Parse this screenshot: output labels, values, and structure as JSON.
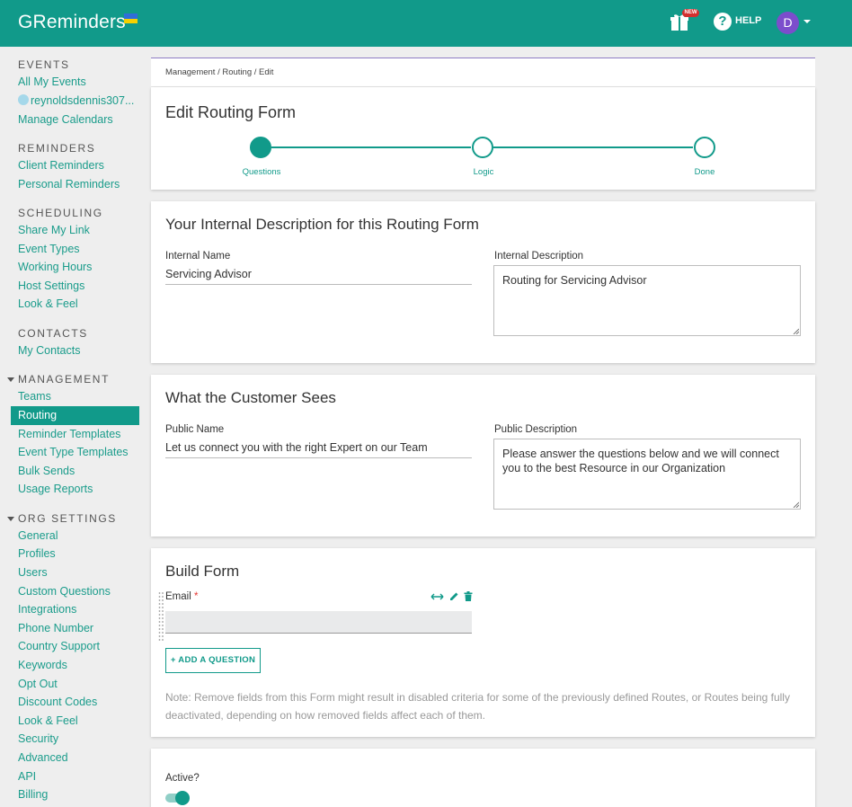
{
  "app": {
    "logo_text": "GReminders",
    "help_label": "HELP",
    "avatar_initial": "D",
    "new_badge": "NEW"
  },
  "sidebar": {
    "events_header": "EVENTS",
    "all_my_events": "All My Events",
    "calendar_account": "reynoldsdennis307...",
    "manage_calendars": "Manage Calendars",
    "reminders_header": "REMINDERS",
    "client_reminders": "Client Reminders",
    "personal_reminders": "Personal Reminders",
    "scheduling_header": "SCHEDULING",
    "share_my_link": "Share My Link",
    "event_types": "Event Types",
    "working_hours": "Working Hours",
    "host_settings": "Host Settings",
    "look_feel_scheduling": "Look & Feel",
    "contacts_header": "CONTACTS",
    "my_contacts": "My Contacts",
    "management_header": "MANAGEMENT",
    "teams": "Teams",
    "routing": "Routing",
    "reminder_templates": "Reminder Templates",
    "event_type_templates": "Event Type Templates",
    "bulk_sends": "Bulk Sends",
    "usage_reports": "Usage Reports",
    "org_settings_header": "ORG SETTINGS",
    "general": "General",
    "profiles": "Profiles",
    "users": "Users",
    "custom_questions": "Custom Questions",
    "integrations": "Integrations",
    "phone_number": "Phone Number",
    "country_support": "Country Support",
    "keywords": "Keywords",
    "opt_out": "Opt Out",
    "discount_codes": "Discount Codes",
    "look_feel_org": "Look & Feel",
    "security": "Security",
    "advanced": "Advanced",
    "api": "API",
    "billing": "Billing"
  },
  "breadcrumb": "Management / Routing / Edit",
  "edit_card": {
    "title": "Edit Routing Form",
    "steps": [
      "Questions",
      "Logic",
      "Done"
    ],
    "current_step": 1
  },
  "internal_card": {
    "title": "Your Internal Description for this Routing Form",
    "name_label": "Internal Name",
    "name_value": "Servicing Advisor",
    "desc_label": "Internal Description",
    "desc_value": "Routing for Servicing Advisor"
  },
  "public_card": {
    "title": "What the Customer Sees",
    "name_label": "Public Name",
    "name_value": "Let us connect you with the right Expert on our Team",
    "desc_label": "Public Description",
    "desc_value": "Please answer the questions below and we will connect you to the best Resource in our Organization"
  },
  "build_card": {
    "title": "Build Form",
    "field_label": "Email",
    "required_mark": "*",
    "add_question": "+ ADD A QUESTION",
    "note": "Note: Remove fields from this Form might result in disabled criteria for some of the previously defined Routes, or Routes being fully deactivated, depending on how removed fields affect each of them."
  },
  "active_card": {
    "label": "Active?",
    "enabled": true
  },
  "colors": {
    "brand": "#119a8a",
    "avatar": "#7c4dcc",
    "badge": "#d32f2f"
  }
}
